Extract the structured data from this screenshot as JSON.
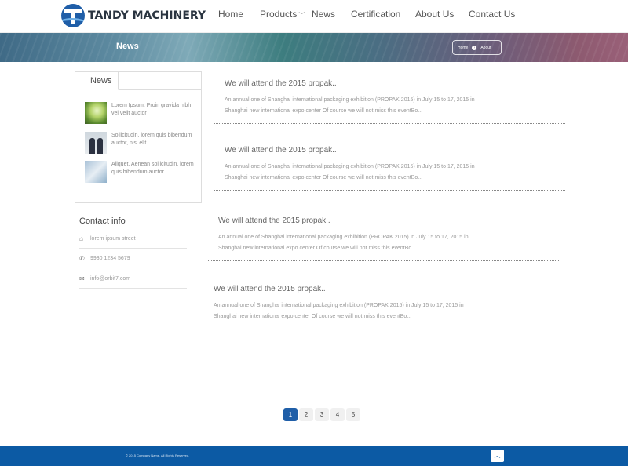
{
  "brand": {
    "name": "TANDY MACHINERY"
  },
  "nav": [
    {
      "label": "Home"
    },
    {
      "label": "Products"
    },
    {
      "label": "News"
    },
    {
      "label": "Certification"
    },
    {
      "label": "About Us"
    },
    {
      "label": "Contact Us"
    }
  ],
  "banner": {
    "title": "News",
    "breadcrumb": {
      "home": "Home",
      "current": "About"
    }
  },
  "sidebar": {
    "tab_label": "News",
    "items": [
      {
        "text": "Lorem Ipsum. Proin gravida nibh vel velit auctor",
        "thumb": "lightbulb-image"
      },
      {
        "text": "Sollicitudin, lorem quis bibendum auctor, nisi elit",
        "thumb": "business-people-image"
      },
      {
        "text": "Aliquet. Aenean sollicitudin, lorem quis bibendum auctor",
        "thumb": "building-image"
      }
    ]
  },
  "contact": {
    "title": "Contact info",
    "address": "lorem ipsum street",
    "phone": "9930 1234 5679",
    "email": "info@orbit7.com"
  },
  "articles": [
    {
      "title": "We will attend the 2015 propak..",
      "line1": "An annual one of Shanghai international packaging exhibition (PROPAK 2015) in July 15 to 17, 2015 in",
      "line2": "Shanghai new international expo center Of course we will not miss this eventBo..."
    },
    {
      "title": "We will attend the 2015 propak..",
      "line1": "An annual one of Shanghai international packaging exhibition (PROPAK 2015) in July 15 to 17, 2015 in",
      "line2": "Shanghai new international expo center Of course we will not miss this eventBo..."
    },
    {
      "title": "We will attend the 2015 propak..",
      "line1": "An annual one of Shanghai international packaging exhibition (PROPAK 2015) in July 15 to 17, 2015 in",
      "line2": "Shanghai new international expo center Of course we will not miss this eventBo..."
    },
    {
      "title": "We will attend the 2015 propak..",
      "line1": "An annual one of Shanghai international packaging exhibition (PROPAK 2015) in July 15 to 17, 2015 in",
      "line2": "Shanghai new international expo center Of course we will not miss this eventBo..."
    }
  ],
  "pagination": {
    "pages": [
      "1",
      "2",
      "3",
      "4",
      "5"
    ],
    "current": "1"
  },
  "footer": {
    "copyright": "© 2015 Company Name. All Rights Reserved.",
    "top_icon": "arrow-up-icon"
  },
  "colors": {
    "primary": "#1f5ea8",
    "footer": "#0c5aa4"
  }
}
